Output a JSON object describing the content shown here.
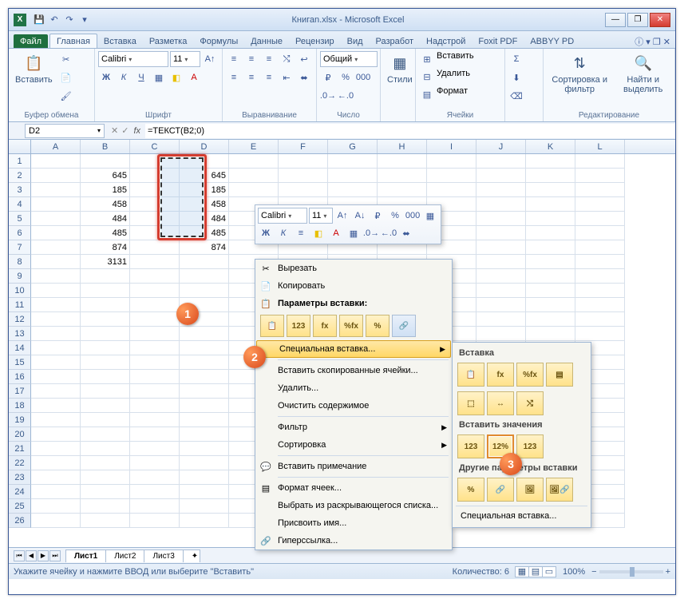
{
  "title": "Книгаn.xlsx - Microsoft Excel",
  "tabs": {
    "file": "Файл",
    "home": "Главная",
    "insert": "Вставка",
    "layout": "Разметка",
    "formulas": "Формулы",
    "data": "Данные",
    "review": "Рецензир",
    "view": "Вид",
    "dev": "Разработ",
    "addins": "Надстрой",
    "foxit": "Foxit PDF",
    "abbyy": "ABBYY PD"
  },
  "ribbon": {
    "paste": "Вставить",
    "clipboard": "Буфер обмена",
    "font": "Шрифт",
    "fontname": "Calibri",
    "fontsize": "11",
    "align": "Выравнивание",
    "number": "Число",
    "numfmt": "Общий",
    "styles": "Стили",
    "cells": "Ячейки",
    "ins": "Вставить",
    "del": "Удалить",
    "fmt": "Формат",
    "editing": "Редактирование",
    "sort": "Сортировка и фильтр",
    "find": "Найти и выделить"
  },
  "namebox": "D2",
  "formula": "=ТЕКСТ(B2;0)",
  "cols": [
    "A",
    "B",
    "C",
    "D",
    "E",
    "F",
    "G",
    "H",
    "I",
    "J",
    "K",
    "L"
  ],
  "rownums": [
    "1",
    "2",
    "3",
    "4",
    "5",
    "6",
    "7",
    "8",
    "9",
    "10",
    "11",
    "12",
    "13",
    "14",
    "15",
    "16",
    "17",
    "18",
    "19",
    "20",
    "21",
    "22",
    "23",
    "24",
    "25",
    "26"
  ],
  "colB": [
    "",
    "645",
    "185",
    "458",
    "484",
    "485",
    "874",
    "3131"
  ],
  "colD": [
    "",
    "645",
    "185",
    "458",
    "484",
    "485",
    "874",
    ""
  ],
  "mini": {
    "font": "Calibri",
    "size": "11"
  },
  "ctx": {
    "cut": "Вырезать",
    "copy": "Копировать",
    "popt": "Параметры вставки:",
    "special": "Специальная вставка...",
    "inscopy": "Вставить скопированные ячейки...",
    "delete": "Удалить...",
    "clear": "Очистить содержимое",
    "filter": "Фильтр",
    "sort": "Сортировка",
    "note": "Вставить примечание",
    "fmtcells": "Формат ячеек...",
    "dropdown": "Выбрать из раскрывающегося списка...",
    "name": "Присвоить имя...",
    "link": "Гиперссылка..."
  },
  "submenu": {
    "h1": "Вставка",
    "h2": "Вставить значения",
    "h3": "Другие параметры вставки",
    "foot": "Специальная вставка..."
  },
  "sheets": [
    "Лист1",
    "Лист2",
    "Лист3"
  ],
  "status": {
    "msg": "Укажите ячейку и нажмите ВВОД или выберите \"Вставить\"",
    "count": "Количество: 6",
    "zoom": "100%"
  },
  "paste_icons": [
    "",
    "123",
    "fx",
    "%fx",
    "%",
    ""
  ],
  "callouts": [
    "1",
    "2",
    "3"
  ]
}
